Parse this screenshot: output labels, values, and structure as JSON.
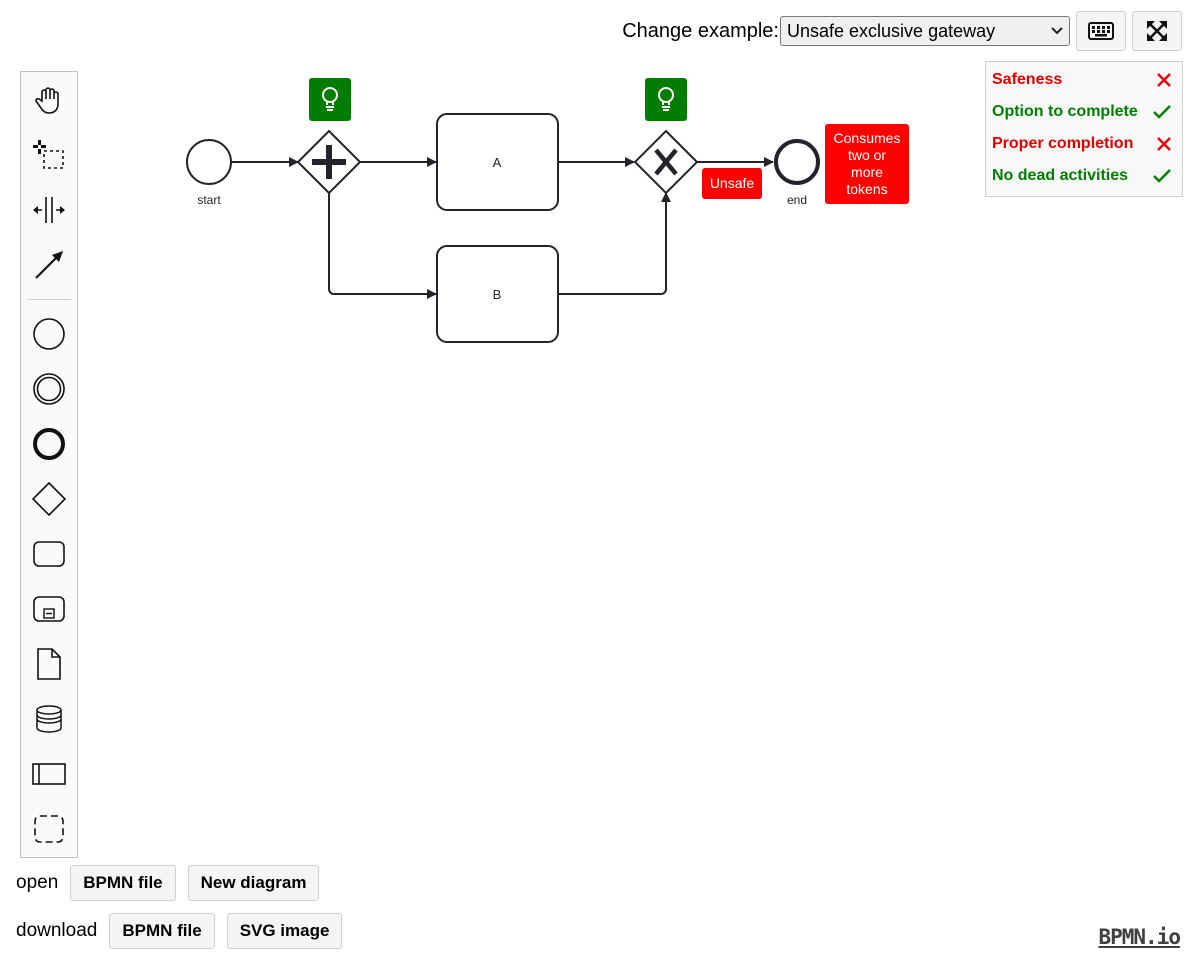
{
  "toolbar": {
    "change_label": "Change example:",
    "example_selected": "Unsafe exclusive gateway",
    "keyboard_icon": "keyboard-icon",
    "fullscreen_icon": "fullscreen-icon"
  },
  "palette": {
    "tools": [
      "hand-tool-icon",
      "lasso-tool-icon",
      "space-tool-icon",
      "connect-tool-icon",
      "start-event-icon",
      "intermediate-event-icon",
      "end-event-icon",
      "gateway-icon",
      "task-icon",
      "subprocess-icon",
      "data-object-icon",
      "data-store-icon",
      "participant-icon",
      "group-icon"
    ]
  },
  "properties": {
    "items": [
      {
        "label": "Safeness",
        "status": "fail"
      },
      {
        "label": "Option to complete",
        "status": "pass"
      },
      {
        "label": "Proper completion",
        "status": "fail"
      },
      {
        "label": "No dead activities",
        "status": "pass"
      }
    ],
    "colors": {
      "fail": "#e60000",
      "pass": "#008000"
    }
  },
  "diagram": {
    "start_label": "start",
    "end_label": "end",
    "task_a": "A",
    "task_b": "B",
    "unsafe_badge": "Unsafe",
    "consumes_badge": [
      "Consumes",
      "two or",
      "more",
      "tokens"
    ],
    "hint_icon": "lightbulb-icon",
    "colors": {
      "hint": "#007d00",
      "error": "#ff0000",
      "stroke": "#22242a"
    }
  },
  "bottom": {
    "open_label": "open",
    "open_bpmn": "BPMN file",
    "new_diagram": "New diagram",
    "download_label": "download",
    "download_bpmn": "BPMN file",
    "svg_image": "SVG image"
  },
  "logo": "BPMN.io"
}
